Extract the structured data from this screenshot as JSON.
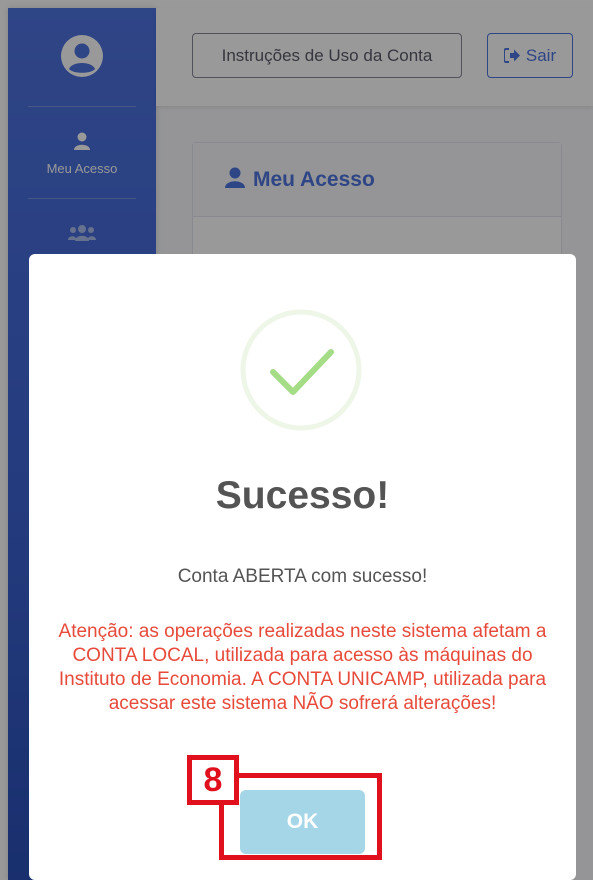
{
  "sidebar": {
    "items": [
      {
        "label": "Meu Acesso",
        "icon": "user-icon"
      },
      {
        "label": "",
        "icon": "users-icon"
      }
    ]
  },
  "topbar": {
    "instructions_label": "Instruções de Uso da Conta",
    "logout_label": "Sair"
  },
  "card": {
    "title": "Meu Acesso"
  },
  "dialog": {
    "title": "Sucesso!",
    "message": "Conta ABERTA com sucesso!",
    "warning": "Atenção: as operações realizadas neste sistema afetam a CONTA LOCAL, utilizada para acesso às máquinas do Instituto de Economia. A CONTA UNICAMP, utilizada para acessar este sistema NÃO sofrerá alterações!",
    "ok_label": "OK"
  },
  "annotation": {
    "step": "8"
  },
  "colors": {
    "primary": "#4e73df",
    "success": "#a5dc86",
    "danger": "#e74a3b",
    "ok_button": "#a5d6e8",
    "annotation": "#e0101c"
  }
}
